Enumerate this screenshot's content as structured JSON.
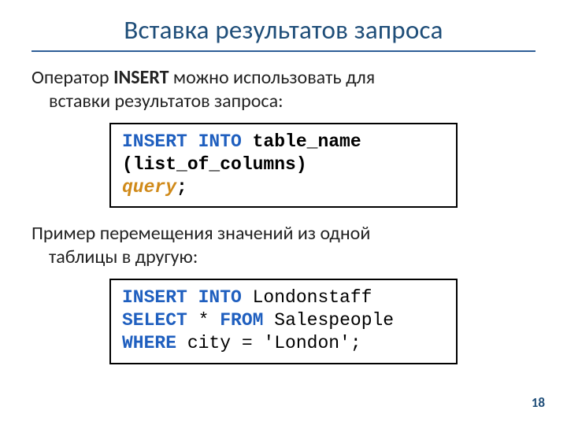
{
  "title": "Вставка результатов запроса",
  "para1_lead": "Оператор ",
  "para1_kw": "INSERT",
  "para1_tail_line1": " можно использовать для",
  "para1_tail_line2": "вставки результатов запроса:",
  "code1": {
    "kw1": "INSERT INTO",
    "id1": " table_name",
    "line2": "(list_of_columns)",
    "qry": "query",
    "semi": ";"
  },
  "para2_line1": "Пример перемещения значений из одной",
  "para2_line2": "таблицы в другую:",
  "code2": {
    "kw1": "INSERT INTO",
    "id1": " Londonstaff",
    "kw2a": "SELECT",
    "star": " * ",
    "kw2b": "FROM",
    "id2": " Salespeople",
    "kw3": "WHERE",
    "tail": " city = 'London';"
  },
  "pagenum": "18"
}
